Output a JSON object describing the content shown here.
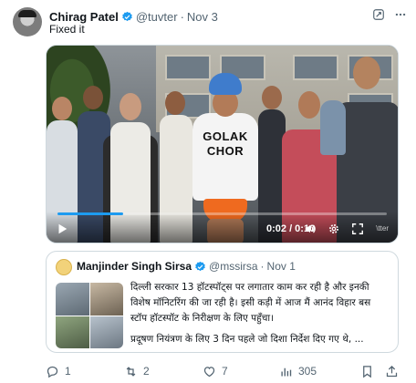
{
  "author": {
    "name": "Chirag Patel",
    "handle": "@tuvter",
    "separator": "·",
    "date": "Nov 3"
  },
  "text": "Fixed it",
  "video": {
    "shirt_line1": "GOLAK",
    "shirt_line2": "CHOR",
    "time": "0:02 / 0:10",
    "progress_fraction": 0.2,
    "watermark": "\\tter"
  },
  "quoted": {
    "name": "Manjinder Singh Sirsa",
    "handle": "@mssirsa",
    "separator": "·",
    "date": "Nov 1",
    "para1": "दिल्ली सरकार 13 हॉटस्पॉट्स पर लगातार काम कर रही है और इनकी विशेष मॉनिटरिंग की जा रही है। इसी कड़ी में आज मैं आनंद विहार बस स्टॉप हॉटस्पॉट के निरीक्षण के लिए पहुँचा।",
    "para2": "प्रदूषण नियंत्रण के लिए 3 दिन पहले जो दिशा निर्देश दिए गए थे, ..."
  },
  "actions": {
    "replies": "1",
    "reposts": "2",
    "likes": "7",
    "views": "305"
  },
  "colors": {
    "accent": "#1d9bf0",
    "secondary_text": "#536471",
    "border": "#cfd9de"
  },
  "icons": [
    "verified-badge-icon",
    "grok-icon",
    "more-icon",
    "play-icon",
    "volume-icon",
    "settings-icon",
    "fullscreen-icon",
    "reply-icon",
    "repost-icon",
    "like-icon",
    "views-icon",
    "bookmark-icon",
    "share-icon"
  ]
}
